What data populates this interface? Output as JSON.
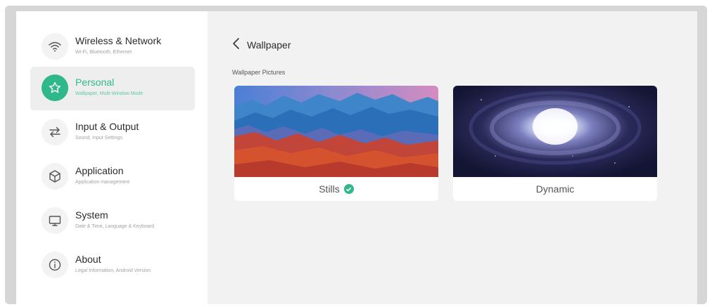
{
  "sidebar": {
    "items": [
      {
        "title": "Wireless & Network",
        "subtitle": "Wi-Fi, Bluetooth, Ethernet",
        "icon": "wifi-icon"
      },
      {
        "title": "Personal",
        "subtitle": "Wallpaper, Multi-Window Mode",
        "icon": "star-icon",
        "active": true
      },
      {
        "title": "Input & Output",
        "subtitle": "Sound, Input Settings",
        "icon": "swap-arrows-icon"
      },
      {
        "title": "Application",
        "subtitle": "Application management",
        "icon": "app-box-icon"
      },
      {
        "title": "System",
        "subtitle": "Date & Time, Language & Keyboard",
        "icon": "monitor-icon"
      },
      {
        "title": "About",
        "subtitle": "Legal Information, Android Version",
        "icon": "info-icon"
      }
    ]
  },
  "header": {
    "title": "Wallpaper",
    "back_icon": "chevron-left-icon"
  },
  "section": {
    "label": "Wallpaper Pictures"
  },
  "cards": [
    {
      "label": "Stills",
      "selected": true
    },
    {
      "label": "Dynamic",
      "selected": false
    }
  ],
  "colors": {
    "accent": "#2fb88a",
    "panel": "#f2f2f2",
    "sidebar": "#ffffff"
  }
}
